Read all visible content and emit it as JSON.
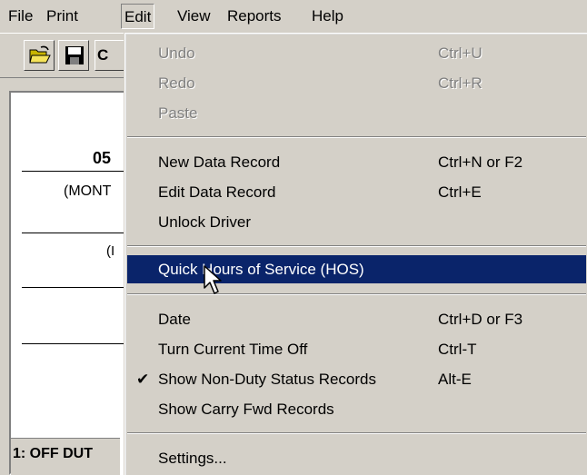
{
  "menubar": {
    "items": [
      {
        "label": "File"
      },
      {
        "label": "Print"
      },
      {
        "label": "Edit"
      },
      {
        "label": "View"
      },
      {
        "label": "Reports"
      },
      {
        "label": "Help"
      }
    ]
  },
  "toolbar": {
    "open_icon": "open-folder-icon",
    "save_icon": "floppy-disk-icon",
    "partial_label": "C"
  },
  "background": {
    "date_value": "05",
    "month_label": "(MONT",
    "partial_paren_1": "(I",
    "status_row": "1: OFF DUT"
  },
  "edit_menu": {
    "items": [
      {
        "label": "Undo",
        "shortcut": "Ctrl+U",
        "enabled": false
      },
      {
        "label": "Redo",
        "shortcut": "Ctrl+R",
        "enabled": false
      },
      {
        "label": "Paste",
        "shortcut": "",
        "enabled": false
      },
      {
        "label": "New Data Record",
        "shortcut": "Ctrl+N or F2",
        "enabled": true
      },
      {
        "label": "Edit Data Record",
        "shortcut": "Ctrl+E",
        "enabled": true
      },
      {
        "label": "Unlock Driver",
        "shortcut": "",
        "enabled": true
      },
      {
        "label": "Quick Hours of Service (HOS)",
        "shortcut": "",
        "enabled": true,
        "selected": true
      },
      {
        "label": "Date",
        "shortcut": "Ctrl+D or F3",
        "enabled": true
      },
      {
        "label": "Turn Current Time Off",
        "shortcut": "Ctrl-T",
        "enabled": true
      },
      {
        "label": "Show Non-Duty Status Records",
        "shortcut": "Alt-E",
        "enabled": true,
        "checked": true
      },
      {
        "label": "Show Carry Fwd Records",
        "shortcut": "",
        "enabled": true
      },
      {
        "label": "Settings...",
        "shortcut": "",
        "enabled": true
      }
    ]
  },
  "colors": {
    "face": "#d4d0c8",
    "highlight": "#0a246a",
    "disabled_text": "#808080"
  }
}
